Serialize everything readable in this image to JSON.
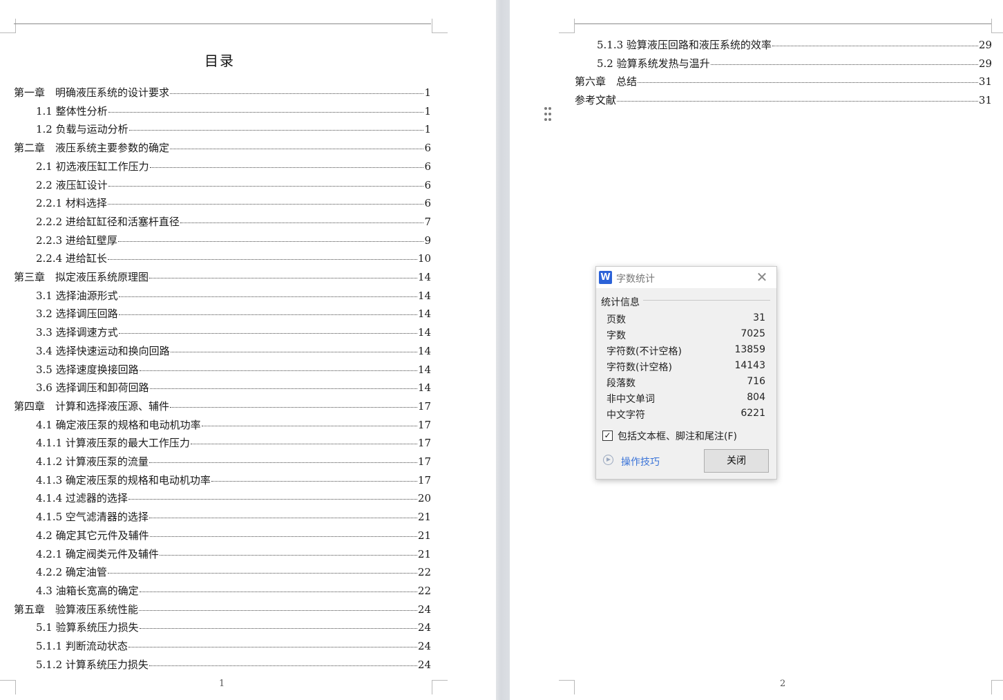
{
  "page1": {
    "title": "目录",
    "footer_page_number": "1",
    "entries": [
      {
        "text": "第一章　明确液压系统的设计要求",
        "page": "1"
      },
      {
        "text": "1.1 整体性分析",
        "page": "1"
      },
      {
        "text": "1.2 负载与运动分析",
        "page": "1"
      },
      {
        "text": "第二章　液压系统主要参数的确定",
        "page": "6"
      },
      {
        "text": "2.1 初选液压缸工作压力",
        "page": "6"
      },
      {
        "text": "2.2 液压缸设计",
        "page": "6"
      },
      {
        "text": "2.2.1 材料选择",
        "page": "6"
      },
      {
        "text": "2.2.2 进给缸缸径和活塞杆直径",
        "page": "7"
      },
      {
        "text": "2.2.3 进给缸壁厚",
        "page": "9"
      },
      {
        "text": "2.2.4 进给缸长",
        "page": "10"
      },
      {
        "text": "第三章　拟定液压系统原理图",
        "page": "14"
      },
      {
        "text": "3.1 选择油源形式",
        "page": "14"
      },
      {
        "text": "3.2 选择调压回路",
        "page": "14"
      },
      {
        "text": "3.3 选择调速方式",
        "page": "14"
      },
      {
        "text": "3.4 选择快速运动和换向回路",
        "page": "14"
      },
      {
        "text": "3.5 选择速度换接回路",
        "page": "14"
      },
      {
        "text": "3.6 选择调压和卸荷回路",
        "page": "14"
      },
      {
        "text": "第四章　计算和选择液压源、辅件",
        "page": "17"
      },
      {
        "text": "4.1 确定液压泵的规格和电动机功率",
        "page": "17"
      },
      {
        "text": "4.1.1 计算液压泵的最大工作压力",
        "page": "17"
      },
      {
        "text": "4.1.2 计算液压泵的流量",
        "page": "17"
      },
      {
        "text": "4.1.3 确定液压泵的规格和电动机功率",
        "page": "17"
      },
      {
        "text": "4.1.4 过滤器的选择",
        "page": "20"
      },
      {
        "text": "4.1.5 空气滤清器的选择",
        "page": "21"
      },
      {
        "text": "4.2 确定其它元件及辅件",
        "page": "21"
      },
      {
        "text": "4.2.1 确定阀类元件及辅件",
        "page": "21"
      },
      {
        "text": "4.2.2 确定油管",
        "page": "22"
      },
      {
        "text": "4.3 油箱长宽高的确定",
        "page": "22"
      },
      {
        "text": "第五章　验算液压系统性能",
        "page": "24"
      },
      {
        "text": "5.1 验算系统压力损失",
        "page": "24"
      },
      {
        "text": "5.1.1 判断流动状态",
        "page": "24"
      },
      {
        "text": "5.1.2 计算系统压力损失",
        "page": "24"
      }
    ]
  },
  "page2": {
    "footer_page_number": "2",
    "entries": [
      {
        "text": "5.1.3 验算液压回路和液压系统的效率",
        "page": "29"
      },
      {
        "text": "5.2 验算系统发热与温升",
        "page": "29"
      },
      {
        "text": "第六章　总结",
        "page": "31"
      },
      {
        "text": "参考文献",
        "page": "31"
      }
    ]
  },
  "dialog": {
    "app_icon": "W",
    "title": "字数统计",
    "section_label": "统计信息",
    "stats": [
      {
        "label": "页数",
        "value": "31"
      },
      {
        "label": "字数",
        "value": "7025"
      },
      {
        "label": "字符数(不计空格)",
        "value": "13859"
      },
      {
        "label": "字符数(计空格)",
        "value": "14143"
      },
      {
        "label": "段落数",
        "value": "716"
      },
      {
        "label": "非中文单词",
        "value": "804"
      },
      {
        "label": "中文字符",
        "value": "6221"
      }
    ],
    "checkbox_label": "包括文本框、脚注和尾注(F)",
    "checkbox_checked": true,
    "tips_link": "操作技巧",
    "close_button": "关闭"
  },
  "colors": {
    "link": "#3b74d8",
    "app_icon_bg": "#2b62d8",
    "gutter": "#dcdfe4"
  }
}
